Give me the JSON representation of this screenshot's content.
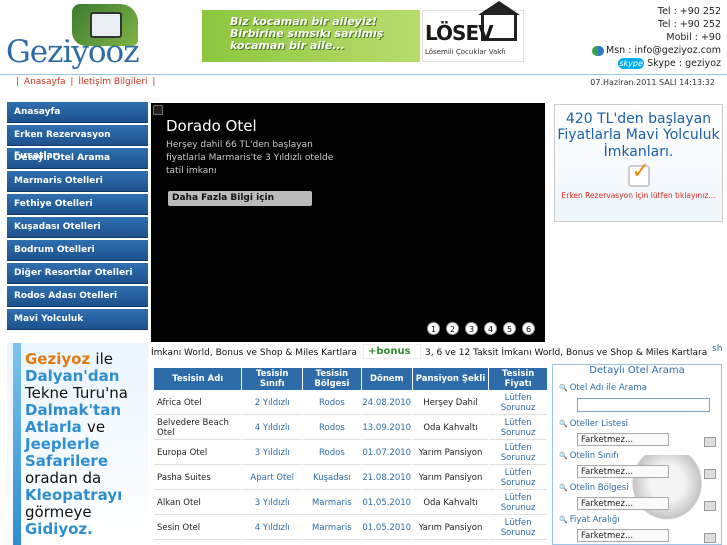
{
  "header": {
    "logo_text": "Geziyooz",
    "banner_slogan": "Biz kocaman bir aileyiz! Birbirine sımsıkı sarılmış kocaman bir aile...",
    "banner_brand": "LÖSEV",
    "banner_brand_sub": "Lösemili Çocuklar Vakfı",
    "contact": {
      "tel1": "Tel : +90 252",
      "tel2": "Tel : +90 252",
      "mobile": "Mobil : +90",
      "msn": "Msn : info@geziyoz.com",
      "skype_badge": "skype",
      "skype": "Skype : geziyoz"
    }
  },
  "nav": {
    "links": [
      "Anasayfa",
      "İletişim Bilgileri"
    ],
    "datetime": "07.Haziran.2011 SALI 14:13:32"
  },
  "sidebar": {
    "items": [
      {
        "label": "Anasayfa"
      },
      {
        "label": "Erken Rezervasyon Fırsatları"
      },
      {
        "label": "Detaylı Otel Arama"
      },
      {
        "label": "Marmaris Otelleri"
      },
      {
        "label": "Fethiye Otelleri"
      },
      {
        "label": "Kuşadası Otelleri"
      },
      {
        "label": "Bodrum Otelleri"
      },
      {
        "label": "Diğer Resortlar Otelleri"
      },
      {
        "label": "Rodos Adası Otelleri"
      },
      {
        "label": "Mavi Yolculuk"
      }
    ]
  },
  "slider": {
    "title": "Dorado Otel",
    "text": "Herşey dahil 66 TL'den başlayan fiyatlarla Marmaris'te 3 Yıldızlı otelde tatil imkanı",
    "button": "Daha Fazla Bilgi için",
    "dots": [
      "1",
      "2",
      "3",
      "4",
      "5",
      "6"
    ]
  },
  "promo": {
    "line1": "420 TL'den başlayan",
    "line2": "Fiyatlarla Mavi Yolculuk",
    "line3": "İmkanları.",
    "cta": "Erken Rezervasyon için lütfen tıklayınız..."
  },
  "ticker": {
    "text1": "İmkanı World, Bonus ve Shop & Miles Kartlara",
    "bonus": "+bonus",
    "text2": "3, 6 ve 12 Taksit İmkanı World, Bonus ve Shop & Miles Kartlara",
    "text3": "sh"
  },
  "left_ad": {
    "brand": "Geziyoz",
    "words": [
      "ile",
      "Dalyan'dan",
      "Tekne Turu'na",
      "Dalmak'tan",
      "Atlarla",
      "ve",
      "Jeeplerle",
      "Safarilere",
      "oradan da",
      "Kleopatrayı",
      "görmeye",
      "Gidiyoz."
    ]
  },
  "table": {
    "headers": [
      "Tesisin Adı",
      "Tesisin Sınıfı",
      "Tesisin Bölgesi",
      "Dönem",
      "Pansiyon Şekli",
      "Tesisin Fiyatı"
    ],
    "rows": [
      [
        "Africa Otel",
        "2 Yıldızlı",
        "Rodos",
        "24.08.2010",
        "Herşey Dahil",
        "Lütfen Sorunuz"
      ],
      [
        "Belvedere Beach Otel",
        "4 Yıldızlı",
        "Rodos",
        "13.09.2010",
        "Oda Kahvaltı",
        "Lütfen Sorunuz"
      ],
      [
        "Europa Otel",
        "3 Yıldızlı",
        "Rodos",
        "01.07.2010",
        "Yarım Pansiyon",
        "Lütfen Sorunuz"
      ],
      [
        "Pasha Suites",
        "Apart Otel",
        "Kuşadası",
        "21.08.2010",
        "Yarım Pansiyon",
        "Lütfen Sorunuz"
      ],
      [
        "Alkan Otel",
        "3 Yıldızlı",
        "Marmaris",
        "01.05.2010",
        "Oda Kahvaltı",
        "Lütfen Sorunuz"
      ],
      [
        "Sesin Otel",
        "4 Yıldızlı",
        "Marmaris",
        "01.05.2010",
        "Yarım Pansiyon",
        "Lütfen Sorunuz"
      ]
    ]
  },
  "search": {
    "title": "Detaylı Otel Arama",
    "hotel_name_label": "Otel Adı ile Arama",
    "hotel_name_value": "",
    "list_label": "Oteller Listesi",
    "class_label": "Otelin Sınıfı",
    "region_label": "Otelin Bölgesi",
    "price_label": "Fiyat Aralığı",
    "select_value": "Farketmez..."
  }
}
